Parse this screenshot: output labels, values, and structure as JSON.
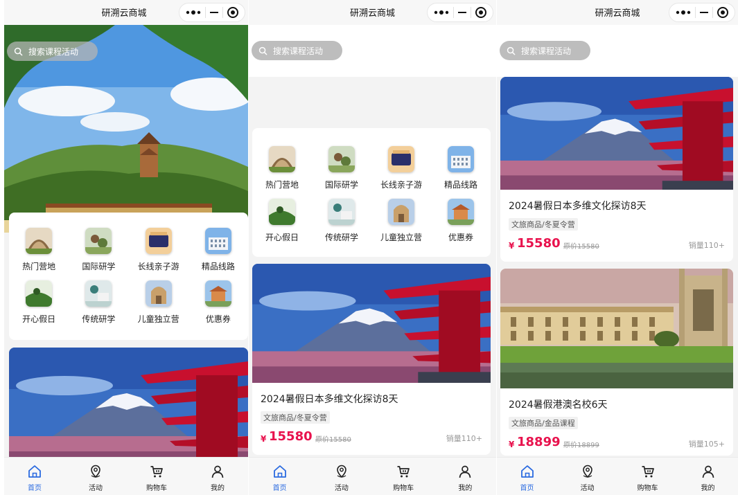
{
  "app": {
    "title": "研溯云商城"
  },
  "search": {
    "placeholder": "搜索课程活动"
  },
  "categories": [
    {
      "label": "热门营地",
      "icon": "camp-photo-icon"
    },
    {
      "label": "国际研学",
      "icon": "international-study-photo-icon"
    },
    {
      "label": "长线亲子游",
      "icon": "family-trip-photo-icon"
    },
    {
      "label": "精品线路",
      "icon": "premium-route-photo-icon"
    },
    {
      "label": "开心假日",
      "icon": "happy-holiday-photo-icon"
    },
    {
      "label": "传统研学",
      "icon": "traditional-study-photo-icon"
    },
    {
      "label": "儿童独立营",
      "icon": "kids-camp-photo-icon"
    },
    {
      "label": "优惠券",
      "icon": "coupon-photo-icon"
    }
  ],
  "products": [
    {
      "title": "2024暑假日本多维文化探访8天",
      "tag": "文旅商品/冬夏令营",
      "currency": "¥",
      "price": "15580",
      "original": "原价15580",
      "sales": "销量110+"
    },
    {
      "title": "2024暑假港澳名校6天",
      "tag": "文旅商品/金品课程",
      "currency": "¥",
      "price": "18899",
      "original": "原价18899",
      "sales": "销量105+"
    }
  ],
  "tabs": [
    {
      "label": "首页",
      "icon": "home-icon",
      "active": true
    },
    {
      "label": "活动",
      "icon": "location-pin-icon",
      "active": false
    },
    {
      "label": "购物车",
      "icon": "cart-icon",
      "active": false
    },
    {
      "label": "我的",
      "icon": "user-icon",
      "active": false
    }
  ],
  "colors": {
    "accent": "#2a6ae0",
    "price": "#e8124d",
    "card": "#ffffff",
    "background": "#f3f3f3"
  }
}
